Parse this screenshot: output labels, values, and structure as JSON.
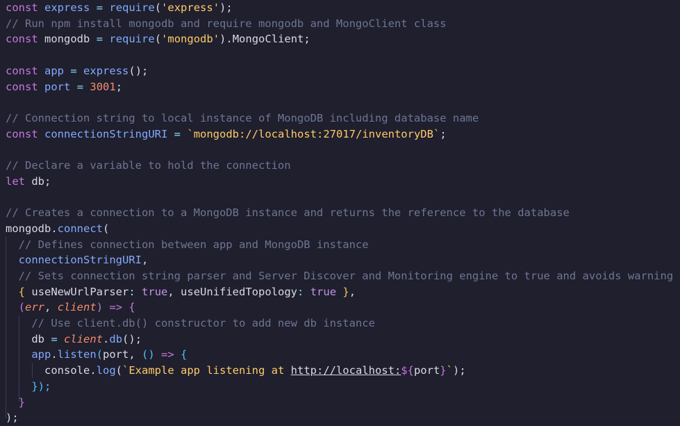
{
  "editor": {
    "lines": [
      [
        {
          "t": "const",
          "c": "kw"
        },
        {
          "t": " ",
          "c": "punc"
        },
        {
          "t": "express",
          "c": "fn"
        },
        {
          "t": " ",
          "c": "punc"
        },
        {
          "t": "=",
          "c": "op"
        },
        {
          "t": " ",
          "c": "punc"
        },
        {
          "t": "require",
          "c": "fn"
        },
        {
          "t": "(",
          "c": "punc"
        },
        {
          "t": "'express'",
          "c": "str"
        },
        {
          "t": ");",
          "c": "punc"
        }
      ],
      [
        {
          "t": "// Run npm install mongodb and require mongodb and MongoClient class",
          "c": "com"
        }
      ],
      [
        {
          "t": "const",
          "c": "kw"
        },
        {
          "t": " ",
          "c": "punc"
        },
        {
          "t": "mongodb",
          "c": "var"
        },
        {
          "t": " ",
          "c": "punc"
        },
        {
          "t": "=",
          "c": "op"
        },
        {
          "t": " ",
          "c": "punc"
        },
        {
          "t": "require",
          "c": "fn"
        },
        {
          "t": "(",
          "c": "punc"
        },
        {
          "t": "'mongodb'",
          "c": "str"
        },
        {
          "t": ").",
          "c": "punc"
        },
        {
          "t": "MongoClient",
          "c": "var"
        },
        {
          "t": ";",
          "c": "punc"
        }
      ],
      [],
      [
        {
          "t": "const",
          "c": "kw"
        },
        {
          "t": " ",
          "c": "punc"
        },
        {
          "t": "app",
          "c": "fn"
        },
        {
          "t": " ",
          "c": "punc"
        },
        {
          "t": "=",
          "c": "op"
        },
        {
          "t": " ",
          "c": "punc"
        },
        {
          "t": "express",
          "c": "fn"
        },
        {
          "t": "();",
          "c": "punc"
        }
      ],
      [
        {
          "t": "const",
          "c": "kw"
        },
        {
          "t": " ",
          "c": "punc"
        },
        {
          "t": "port",
          "c": "fn"
        },
        {
          "t": " ",
          "c": "punc"
        },
        {
          "t": "=",
          "c": "op"
        },
        {
          "t": " ",
          "c": "punc"
        },
        {
          "t": "3001",
          "c": "num"
        },
        {
          "t": ";",
          "c": "punc"
        }
      ],
      [],
      [
        {
          "t": "// Connection string to local instance of MongoDB including database name",
          "c": "com"
        }
      ],
      [
        {
          "t": "const",
          "c": "kw"
        },
        {
          "t": " ",
          "c": "punc"
        },
        {
          "t": "connectionStringURI",
          "c": "fn"
        },
        {
          "t": " ",
          "c": "punc"
        },
        {
          "t": "=",
          "c": "op"
        },
        {
          "t": " ",
          "c": "punc"
        },
        {
          "t": "`mongodb://localhost:27017/inventoryDB`",
          "c": "str"
        },
        {
          "t": ";",
          "c": "punc"
        }
      ],
      [],
      [
        {
          "t": "// Declare a variable to hold the connection",
          "c": "com"
        }
      ],
      [
        {
          "t": "let",
          "c": "kw"
        },
        {
          "t": " ",
          "c": "punc"
        },
        {
          "t": "db",
          "c": "var"
        },
        {
          "t": ";",
          "c": "punc"
        }
      ],
      [],
      [
        {
          "t": "// Creates a connection to a MongoDB instance and returns the reference to the database",
          "c": "com"
        }
      ],
      [
        {
          "t": "mongodb",
          "c": "var"
        },
        {
          "t": ".",
          "c": "punc"
        },
        {
          "t": "connect",
          "c": "fn"
        },
        {
          "t": "(",
          "c": "punc"
        }
      ],
      [
        {
          "t": "  ",
          "c": "punc"
        },
        {
          "t": "// Defines connection between app and MongoDB instance",
          "c": "com"
        }
      ],
      [
        {
          "t": "  ",
          "c": "punc"
        },
        {
          "t": "connectionStringURI",
          "c": "fn"
        },
        {
          "t": ",",
          "c": "punc"
        }
      ],
      [
        {
          "t": "  ",
          "c": "punc"
        },
        {
          "t": "// Sets connection string parser and Server Discover and Monitoring engine to true and avoids warning",
          "c": "com"
        }
      ],
      [
        {
          "t": "  ",
          "c": "punc"
        },
        {
          "t": "{",
          "c": "brace1"
        },
        {
          "t": " ",
          "c": "punc"
        },
        {
          "t": "useNewUrlParser",
          "c": "var"
        },
        {
          "t": ":",
          "c": "op"
        },
        {
          "t": " ",
          "c": "punc"
        },
        {
          "t": "true",
          "c": "bool"
        },
        {
          "t": ", ",
          "c": "punc"
        },
        {
          "t": "useUnifiedTopology",
          "c": "var"
        },
        {
          "t": ":",
          "c": "op"
        },
        {
          "t": " ",
          "c": "punc"
        },
        {
          "t": "true",
          "c": "bool"
        },
        {
          "t": " ",
          "c": "punc"
        },
        {
          "t": "}",
          "c": "brace1"
        },
        {
          "t": ",",
          "c": "punc"
        }
      ],
      [
        {
          "t": "  ",
          "c": "punc"
        },
        {
          "t": "(",
          "c": "brace2"
        },
        {
          "t": "err",
          "c": "param"
        },
        {
          "t": ", ",
          "c": "punc"
        },
        {
          "t": "client",
          "c": "param"
        },
        {
          "t": ")",
          "c": "brace2"
        },
        {
          "t": " ",
          "c": "punc"
        },
        {
          "t": "=>",
          "c": "kw"
        },
        {
          "t": " ",
          "c": "punc"
        },
        {
          "t": "{",
          "c": "brace2"
        }
      ],
      [
        {
          "t": "    ",
          "c": "punc"
        },
        {
          "t": "// Use client.db() constructor to add new db instance",
          "c": "com"
        }
      ],
      [
        {
          "t": "    ",
          "c": "punc"
        },
        {
          "t": "db",
          "c": "var"
        },
        {
          "t": " ",
          "c": "punc"
        },
        {
          "t": "=",
          "c": "op"
        },
        {
          "t": " ",
          "c": "punc"
        },
        {
          "t": "client",
          "c": "param"
        },
        {
          "t": ".",
          "c": "punc"
        },
        {
          "t": "db",
          "c": "fn"
        },
        {
          "t": "();",
          "c": "punc"
        }
      ],
      [
        {
          "t": "    ",
          "c": "punc"
        },
        {
          "t": "app",
          "c": "fn"
        },
        {
          "t": ".",
          "c": "punc"
        },
        {
          "t": "listen",
          "c": "fn"
        },
        {
          "t": "(",
          "c": "brace3"
        },
        {
          "t": "port",
          "c": "var"
        },
        {
          "t": ", ",
          "c": "punc"
        },
        {
          "t": "()",
          "c": "brace3"
        },
        {
          "t": " ",
          "c": "punc"
        },
        {
          "t": "=>",
          "c": "kw"
        },
        {
          "t": " ",
          "c": "punc"
        },
        {
          "t": "{",
          "c": "brace3"
        }
      ],
      [
        {
          "t": "      ",
          "c": "punc"
        },
        {
          "t": "console",
          "c": "var"
        },
        {
          "t": ".",
          "c": "punc"
        },
        {
          "t": "log",
          "c": "fn"
        },
        {
          "t": "(",
          "c": "punc"
        },
        {
          "t": "`Example app listening at ",
          "c": "str"
        },
        {
          "t": "http://localhost:",
          "c": "url"
        },
        {
          "t": "${",
          "c": "tmpl"
        },
        {
          "t": "port",
          "c": "var"
        },
        {
          "t": "}",
          "c": "tmpl"
        },
        {
          "t": "`",
          "c": "str"
        },
        {
          "t": ");",
          "c": "punc"
        }
      ],
      [
        {
          "t": "    ",
          "c": "punc"
        },
        {
          "t": "});",
          "c": "brace3"
        }
      ],
      [
        {
          "t": "  ",
          "c": "punc"
        },
        {
          "t": "}",
          "c": "brace2"
        }
      ],
      [
        {
          "t": ");",
          "c": "punc"
        }
      ]
    ]
  },
  "theme": {
    "background": "#1f1f2d",
    "comment": "#6f7694",
    "keyword": "#c678dd",
    "function": "#82aaff",
    "string": "#ffcb6b",
    "number": "#f78c6c",
    "operator": "#89ddff",
    "text": "#d8dbe6"
  }
}
